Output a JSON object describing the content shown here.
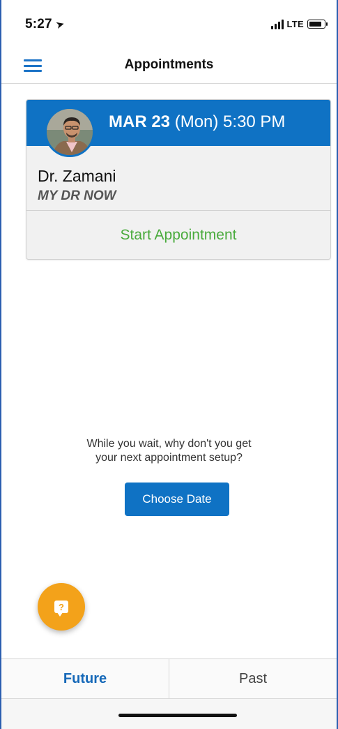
{
  "status_bar": {
    "time": "5:27",
    "location_icon": "location-arrow-icon",
    "network": "LTE",
    "signal_icon": "signal-bars-icon",
    "battery_icon": "battery-icon"
  },
  "nav": {
    "menu_icon": "hamburger-menu-icon",
    "title": "Appointments"
  },
  "appointment": {
    "date": "MAR 23",
    "day": "(Mon)",
    "time": "5:30 PM",
    "doctor_name": "Dr. Zamani",
    "practice": "MY DR NOW",
    "start_label": "Start Appointment"
  },
  "prompt": {
    "line1": "While you wait, why don't you get",
    "line2": "your next appointment setup?",
    "choose_date_label": "Choose Date"
  },
  "help": {
    "icon": "help-chat-icon",
    "glyph": "?"
  },
  "tabs": [
    {
      "label": "Future",
      "active": true
    },
    {
      "label": "Past",
      "active": false
    }
  ],
  "colors": {
    "primary_blue": "#0f72c4",
    "start_green": "#4aab3d",
    "help_orange": "#f3a21a",
    "tab_active": "#1568b8"
  }
}
